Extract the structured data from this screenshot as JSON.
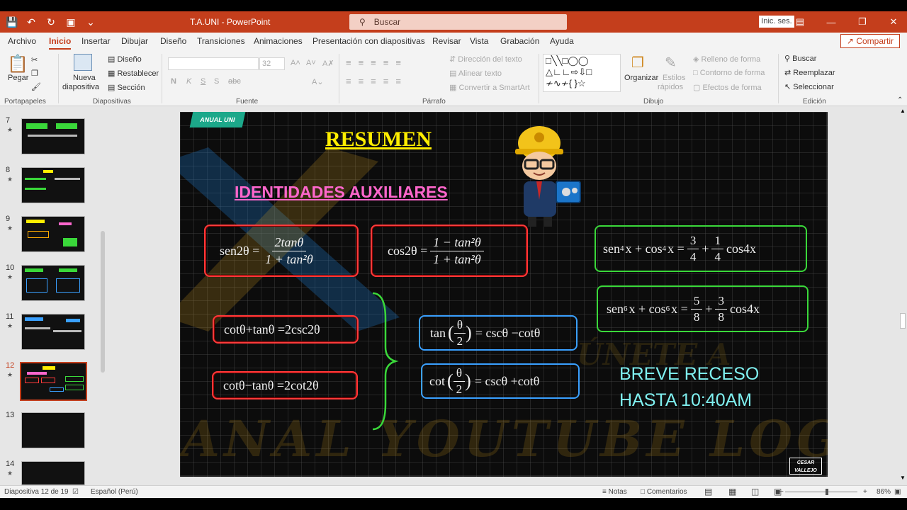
{
  "window": {
    "title": "T.A.UNI  -  PowerPoint",
    "search_placeholder": "Buscar",
    "signin": "Inic. ses."
  },
  "menu": {
    "tabs": [
      "Archivo",
      "Inicio",
      "Insertar",
      "Dibujar",
      "Diseño",
      "Transiciones",
      "Animaciones",
      "Presentación con diapositivas",
      "Revisar",
      "Vista",
      "Grabación",
      "Ayuda"
    ],
    "share": "Compartir"
  },
  "ribbon": {
    "portapapeles": {
      "paste": "Pegar",
      "label": "Portapapeles"
    },
    "diapositivas": {
      "new_slide_1": "Nueva",
      "new_slide_2": "diapositiva",
      "layout": "Diseño",
      "reset": "Restablecer",
      "section": "Sección",
      "label": "Diapositivas"
    },
    "fuente": {
      "size": "32",
      "bold": "N",
      "italic": "K",
      "underline": "S",
      "shadow": "S",
      "strike": "abc",
      "label": "Fuente"
    },
    "parrafo": {
      "text_dir": "Dirección del texto",
      "align": "Alinear texto",
      "smartart": "Convertir a SmartArt",
      "label": "Párrafo"
    },
    "dibujo": {
      "arrange": "Organizar",
      "styles_1": "Estilos",
      "styles_2": "rápidos",
      "fill": "Relleno de forma",
      "outline": "Contorno de forma",
      "effects": "Efectos de forma",
      "label": "Dibujo"
    },
    "edicion": {
      "find": "Buscar",
      "replace": "Reemplazar",
      "select": "Seleccionar",
      "label": "Edición"
    }
  },
  "thumbnails": [
    {
      "num": "7",
      "star": "★"
    },
    {
      "num": "8",
      "star": "★"
    },
    {
      "num": "9",
      "star": "★"
    },
    {
      "num": "10",
      "star": "★"
    },
    {
      "num": "11",
      "star": "★"
    },
    {
      "num": "12",
      "star": "★"
    },
    {
      "num": "13",
      "star": ""
    },
    {
      "num": "14",
      "star": "★"
    }
  ],
  "slide": {
    "badge": "ANUAL UNI",
    "title": "RESUMEN",
    "subtitle": "IDENTIDADES AUXILIARES",
    "f1": {
      "lhs": "sen2θ =",
      "num": "2tanθ",
      "den": "1 + tan²θ"
    },
    "f2": {
      "lhs": "cos2θ =",
      "num": "1 − tan²θ",
      "den": "1 + tan²θ"
    },
    "f3": {
      "a": "sen",
      "b": "x + cos",
      "c": "x =",
      "n1": "3",
      "d1": "4",
      "n2": "1",
      "d2": "4",
      "tail": "cos4x"
    },
    "f4": {
      "a": "sen",
      "b": "x + cos",
      "c": "x =",
      "n1": "5",
      "d1": "8",
      "n2": "3",
      "d2": "8",
      "tail": "cos4x"
    },
    "f5": "cotθ+tanθ =2csc2θ",
    "f6": "cotθ−tanθ =2cot2θ",
    "f7": {
      "fn": "tan",
      "num": "θ",
      "den": "2",
      "rhs": "= cscθ −cotθ"
    },
    "f8": {
      "fn": "cot",
      "num": "θ",
      "den": "2",
      "rhs": "= cscθ +cotθ"
    },
    "break_line1": "BREVE RECESO",
    "break_line2": "HASTA 10:40AM",
    "watermark": "CANAL YOUTUBE LOGAN MATHS",
    "watermark_sub": "ÚNETE A",
    "corner_logo_1": "CESAR",
    "corner_logo_2": "VALLEJO"
  },
  "status": {
    "slide_info": "Diapositiva 12 de 19",
    "language": "Español (Perú)",
    "notes": "Notas",
    "comments": "Comentarios",
    "zoom": "86%"
  },
  "colors": {
    "accent": "#c43e1c",
    "title_yellow": "#ffee00",
    "subtitle_pink": "#ff66cc",
    "break_cyan": "#7ff0f0"
  }
}
